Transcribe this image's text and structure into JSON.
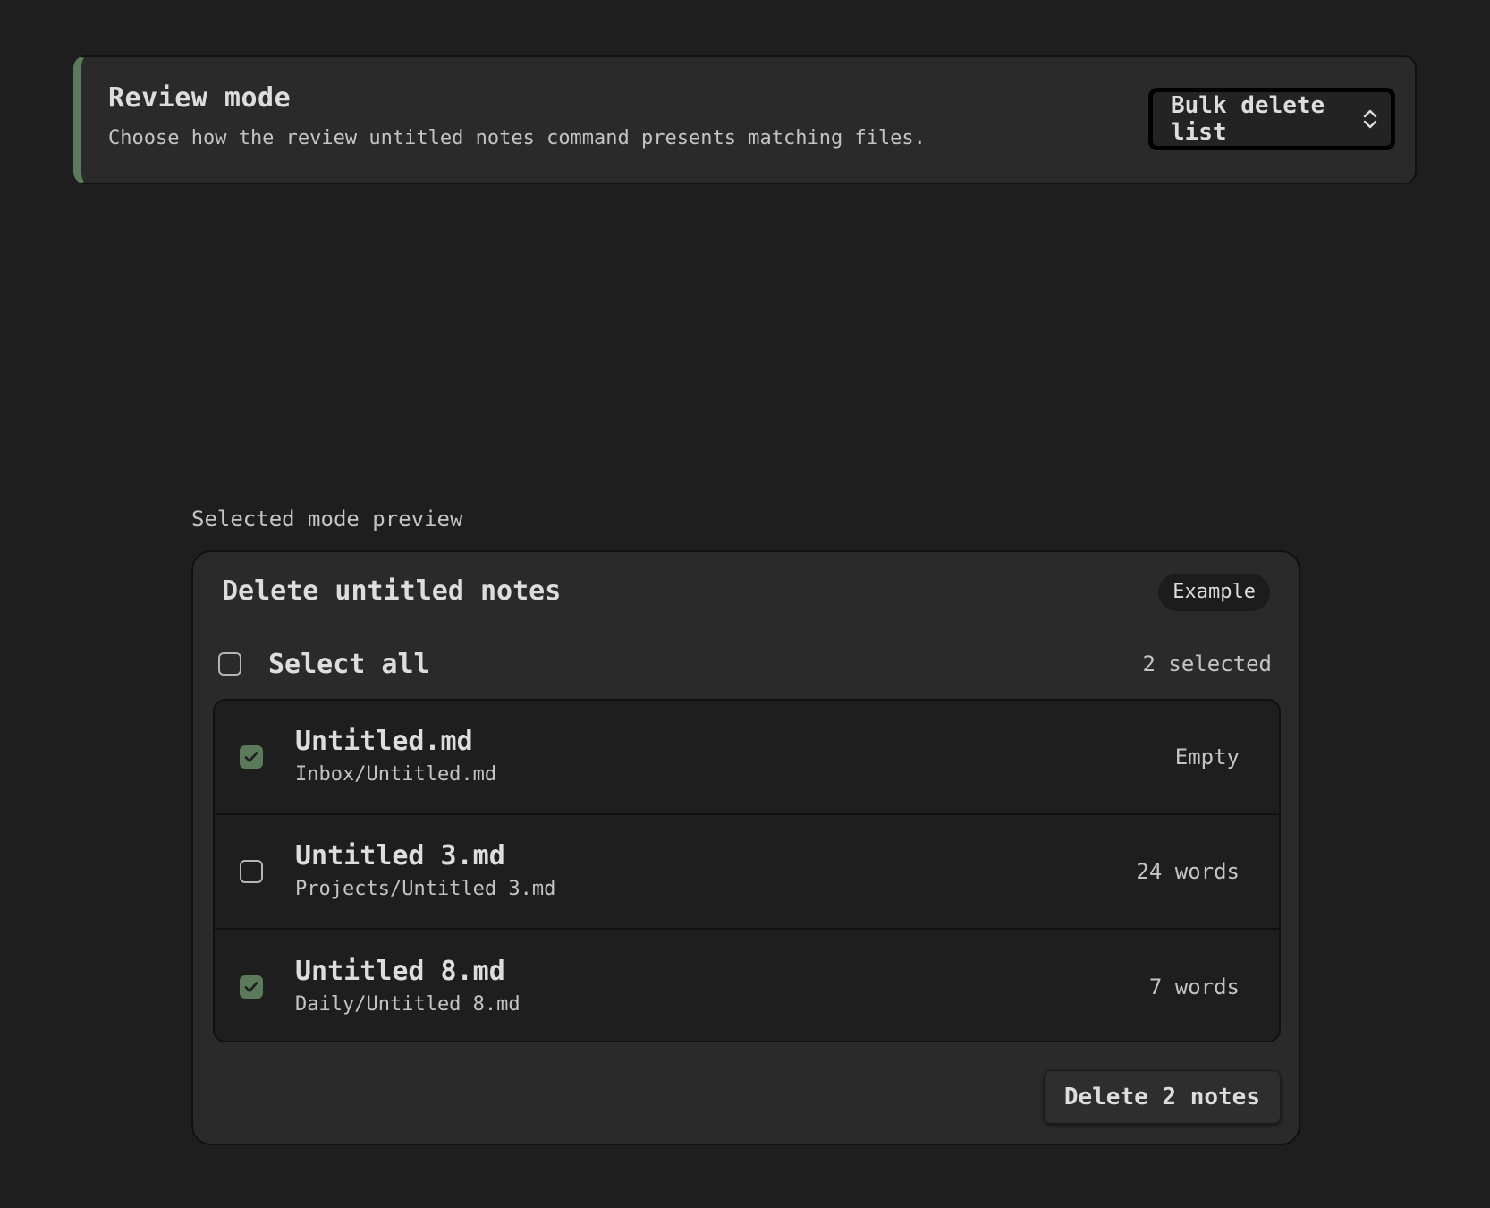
{
  "setting": {
    "name": "Review mode",
    "description": "Choose how the review untitled notes command presents matching files.",
    "selected_value": "Bulk delete list",
    "accent_color": "#5b7a5c"
  },
  "preview": {
    "label": "Selected mode preview",
    "title": "Delete untitled notes",
    "badge": "Example",
    "select_all_label": "Select all",
    "selected_count": "2 selected",
    "files": [
      {
        "name": "Untitled.md",
        "path": "Inbox/Untitled.md",
        "meta": "Empty",
        "checked": true
      },
      {
        "name": "Untitled 3.md",
        "path": "Projects/Untitled 3.md",
        "meta": "24 words",
        "checked": false
      },
      {
        "name": "Untitled 8.md",
        "path": "Daily/Untitled 8.md",
        "meta": "7 words",
        "checked": true
      }
    ],
    "delete_button_label": "Delete 2 notes"
  },
  "icons": {
    "select_chevron": "chevron-up-down-icon",
    "checkmark": "checkmark-icon"
  }
}
